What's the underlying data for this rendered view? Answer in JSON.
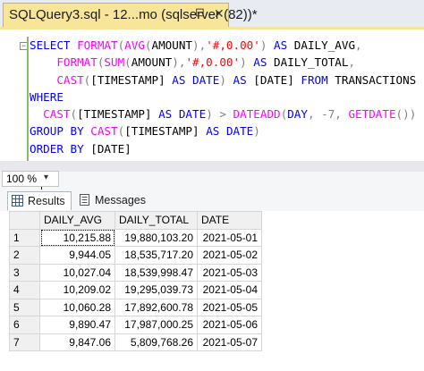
{
  "tab": {
    "title": "SQLQuery3.sql - 12...mo (sqlserver (82))*",
    "pin_icon": "pin-icon",
    "close_icon": "close-icon"
  },
  "editor": {
    "lines": [
      [
        {
          "t": "SELECT ",
          "c": "kw"
        },
        {
          "t": "FORMAT",
          "c": "fn"
        },
        {
          "t": "(",
          "c": "op"
        },
        {
          "t": "AVG",
          "c": "fn"
        },
        {
          "t": "(",
          "c": "op"
        },
        {
          "t": "AMOUNT",
          "c": ""
        },
        {
          "t": "),",
          "c": "op"
        },
        {
          "t": "'#,0.00'",
          "c": "str"
        },
        {
          "t": ") ",
          "c": "op"
        },
        {
          "t": "AS ",
          "c": "kw"
        },
        {
          "t": "DAILY_AVG",
          "c": ""
        },
        {
          "t": ",",
          "c": "op"
        }
      ],
      [
        {
          "t": "    FORMAT",
          "c": "fn"
        },
        {
          "t": "(",
          "c": "op"
        },
        {
          "t": "SUM",
          "c": "fn"
        },
        {
          "t": "(",
          "c": "op"
        },
        {
          "t": "AMOUNT",
          "c": ""
        },
        {
          "t": "),",
          "c": "op"
        },
        {
          "t": "'#,0.00'",
          "c": "str"
        },
        {
          "t": ") ",
          "c": "op"
        },
        {
          "t": "AS ",
          "c": "kw"
        },
        {
          "t": "DAILY_TOTAL",
          "c": ""
        },
        {
          "t": ",",
          "c": "op"
        }
      ],
      [
        {
          "t": "    CAST",
          "c": "fn"
        },
        {
          "t": "(",
          "c": "op"
        },
        {
          "t": "[TIMESTAMP] ",
          "c": ""
        },
        {
          "t": "AS ",
          "c": "kw"
        },
        {
          "t": "DATE",
          "c": "kw"
        },
        {
          "t": ") ",
          "c": "op"
        },
        {
          "t": "AS ",
          "c": "kw"
        },
        {
          "t": "[DATE] ",
          "c": ""
        },
        {
          "t": "FROM ",
          "c": "kw"
        },
        {
          "t": "TRANSACTIONS",
          "c": ""
        }
      ],
      [
        {
          "t": "WHERE",
          "c": "kw"
        }
      ],
      [
        {
          "t": "  CAST",
          "c": "fn"
        },
        {
          "t": "(",
          "c": "op"
        },
        {
          "t": "[TIMESTAMP] ",
          "c": ""
        },
        {
          "t": "AS ",
          "c": "kw"
        },
        {
          "t": "DATE",
          "c": "kw"
        },
        {
          "t": ") > ",
          "c": "op"
        },
        {
          "t": "DATEADD",
          "c": "fn"
        },
        {
          "t": "(",
          "c": "op"
        },
        {
          "t": "DAY",
          "c": "kw"
        },
        {
          "t": ", ",
          "c": "op"
        },
        {
          "t": "-7",
          "c": "op"
        },
        {
          "t": ", ",
          "c": "op"
        },
        {
          "t": "GETDATE",
          "c": "fn"
        },
        {
          "t": "())",
          "c": "op"
        }
      ],
      [
        {
          "t": "GROUP BY ",
          "c": "kw"
        },
        {
          "t": "CAST",
          "c": "fn"
        },
        {
          "t": "(",
          "c": "op"
        },
        {
          "t": "[TIMESTAMP] ",
          "c": ""
        },
        {
          "t": "AS ",
          "c": "kw"
        },
        {
          "t": "DATE",
          "c": "kw"
        },
        {
          "t": ")",
          "c": "op"
        }
      ],
      [
        {
          "t": "ORDER BY ",
          "c": "kw"
        },
        {
          "t": "[DATE]",
          "c": ""
        }
      ]
    ]
  },
  "zoom": {
    "value": "100 %",
    "arrow_icon": "chevron-down-icon"
  },
  "results_tabs": {
    "results_label": "Results",
    "results_icon": "grid-icon",
    "messages_label": "Messages",
    "messages_icon": "messages-icon"
  },
  "grid": {
    "columns": [
      "DAILY_AVG",
      "DAILY_TOTAL",
      "DATE"
    ],
    "rows": [
      {
        "n": "1",
        "avg": "10,215.88",
        "total": "19,880,103.20",
        "date": "2021-05-01"
      },
      {
        "n": "2",
        "avg": "9,944.05",
        "total": "18,535,717.20",
        "date": "2021-05-02"
      },
      {
        "n": "3",
        "avg": "10,027.04",
        "total": "18,539,998.47",
        "date": "2021-05-03"
      },
      {
        "n": "4",
        "avg": "10,209.02",
        "total": "19,295,039.73",
        "date": "2021-05-04"
      },
      {
        "n": "5",
        "avg": "10,060.28",
        "total": "17,892,600.78",
        "date": "2021-05-05"
      },
      {
        "n": "6",
        "avg": "9,890.47",
        "total": "17,987,000.25",
        "date": "2021-05-06"
      },
      {
        "n": "7",
        "avg": "9,847.06",
        "total": "5,809,768.26",
        "date": "2021-05-07"
      }
    ]
  }
}
